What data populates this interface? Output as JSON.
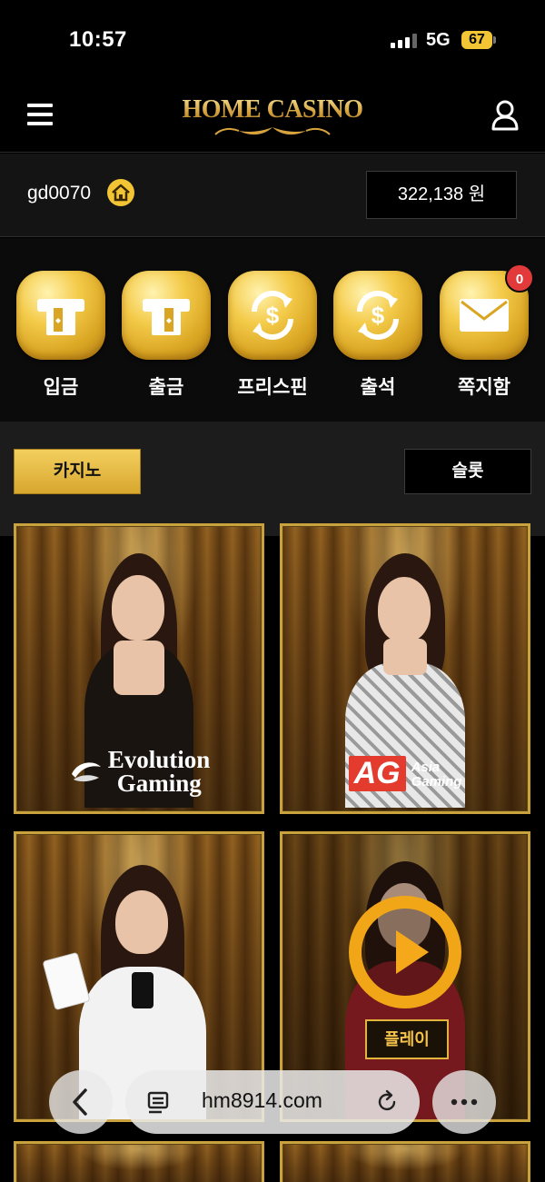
{
  "status_bar": {
    "time": "10:57",
    "network": "5G",
    "battery": "67"
  },
  "header": {
    "logo_text": "HOME CASINO"
  },
  "account": {
    "username": "gd0070",
    "balance": "322,138 원"
  },
  "quick_menu": [
    {
      "label": "입금",
      "icon": "atm-card-icon"
    },
    {
      "label": "출금",
      "icon": "atm-card-icon"
    },
    {
      "label": "프리스핀",
      "icon": "dollar-refresh-icon"
    },
    {
      "label": "출석",
      "icon": "dollar-refresh-icon"
    },
    {
      "label": "쪽지함",
      "icon": "envelope-icon",
      "badge": "0"
    }
  ],
  "tabs": {
    "casino": "카지노",
    "slot": "슬롯"
  },
  "games": [
    {
      "line1": "Evolution",
      "line2": "Gaming"
    },
    {
      "logo": "AG",
      "line1": "Asia",
      "line2": "Gaming"
    },
    {},
    {
      "play_label": "플레이"
    }
  ],
  "browser": {
    "url": "hm8914.com"
  },
  "colors": {
    "gold": "#f2c535",
    "badge_red": "#e23a3a",
    "background": "#000000"
  }
}
